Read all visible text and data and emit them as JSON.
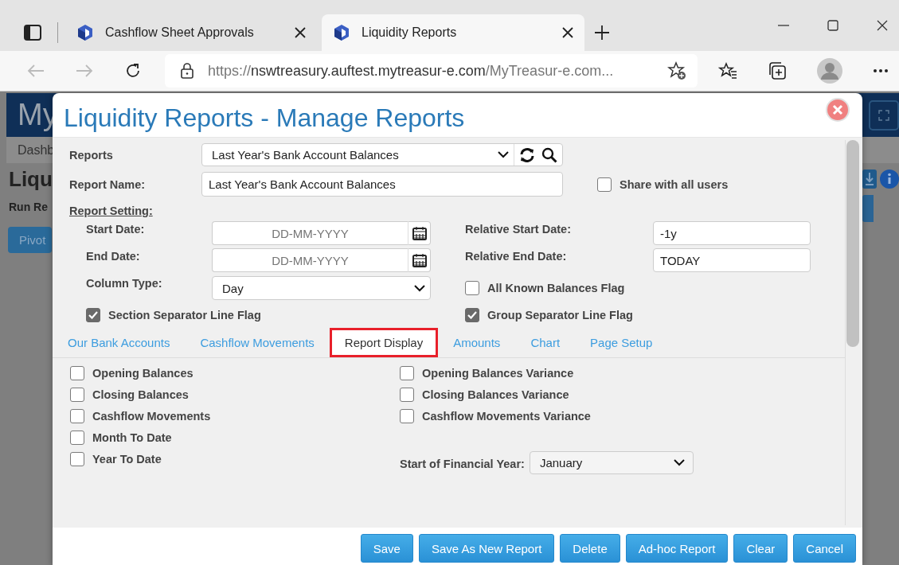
{
  "browser": {
    "tabs": [
      {
        "title": "Cashflow Sheet Approvals",
        "selected": false
      },
      {
        "title": "Liquidity Reports",
        "selected": true
      }
    ],
    "url": {
      "scheme": "https://",
      "host": "nswtreasury.auftest.mytreasur-e.com",
      "path": "/MyTreasur-e.com..."
    }
  },
  "background_page": {
    "logo": "My",
    "nav_item": "Dashb",
    "heading": "Liqu",
    "run_label": "Run Re",
    "pivot_button": "Pivot"
  },
  "dialog": {
    "title": "Liquidity Reports - Manage Reports",
    "reports": {
      "label": "Reports",
      "value": "Last Year's Bank Account Balances"
    },
    "report_name": {
      "label": "Report Name:",
      "value": "Last Year's Bank Account Balances"
    },
    "share": {
      "label": "Share with all users",
      "checked": false
    },
    "section_title": "Report Setting:",
    "settings_left": [
      {
        "kind": "date",
        "label": "Start Date:",
        "placeholder": "DD-MM-YYYY"
      },
      {
        "kind": "date",
        "label": "End Date:",
        "placeholder": "DD-MM-YYYY"
      },
      {
        "kind": "select",
        "label": "Column Type:",
        "value": "Day"
      },
      {
        "kind": "checkbox",
        "label": "Section Separator Line Flag",
        "checked": true
      }
    ],
    "settings_right": [
      {
        "kind": "text",
        "label": "Relative Start Date:",
        "value": "-1y"
      },
      {
        "kind": "text",
        "label": "Relative End Date:",
        "value": "TODAY"
      },
      {
        "kind": "checkbox",
        "label": "All Known Balances Flag",
        "checked": false
      },
      {
        "kind": "checkbox",
        "label": "Group Separator Line Flag",
        "checked": true
      }
    ],
    "tabs": [
      {
        "label": "Our Bank Accounts",
        "selected": false
      },
      {
        "label": "Cashflow Movements",
        "selected": false
      },
      {
        "label": "Report Display",
        "selected": true
      },
      {
        "label": "Amounts",
        "selected": false
      },
      {
        "label": "Chart",
        "selected": false
      },
      {
        "label": "Page Setup",
        "selected": false
      }
    ],
    "display_left": [
      {
        "label": "Opening Balances",
        "checked": false
      },
      {
        "label": "Closing Balances",
        "checked": false
      },
      {
        "label": "Cashflow Movements",
        "checked": false
      },
      {
        "label": "Month To Date",
        "checked": false
      },
      {
        "label": "Year To Date",
        "checked": false
      }
    ],
    "display_right": [
      {
        "label": "Opening Balances Variance",
        "checked": false
      },
      {
        "label": "Closing Balances Variance",
        "checked": false
      },
      {
        "label": "Cashflow Movements Variance",
        "checked": false
      }
    ],
    "financial_year": {
      "label": "Start of Financial Year:",
      "value": "January"
    },
    "buttons": [
      "Save",
      "Save As New Report",
      "Delete",
      "Ad-hoc Report",
      "Clear",
      "Cancel"
    ]
  }
}
